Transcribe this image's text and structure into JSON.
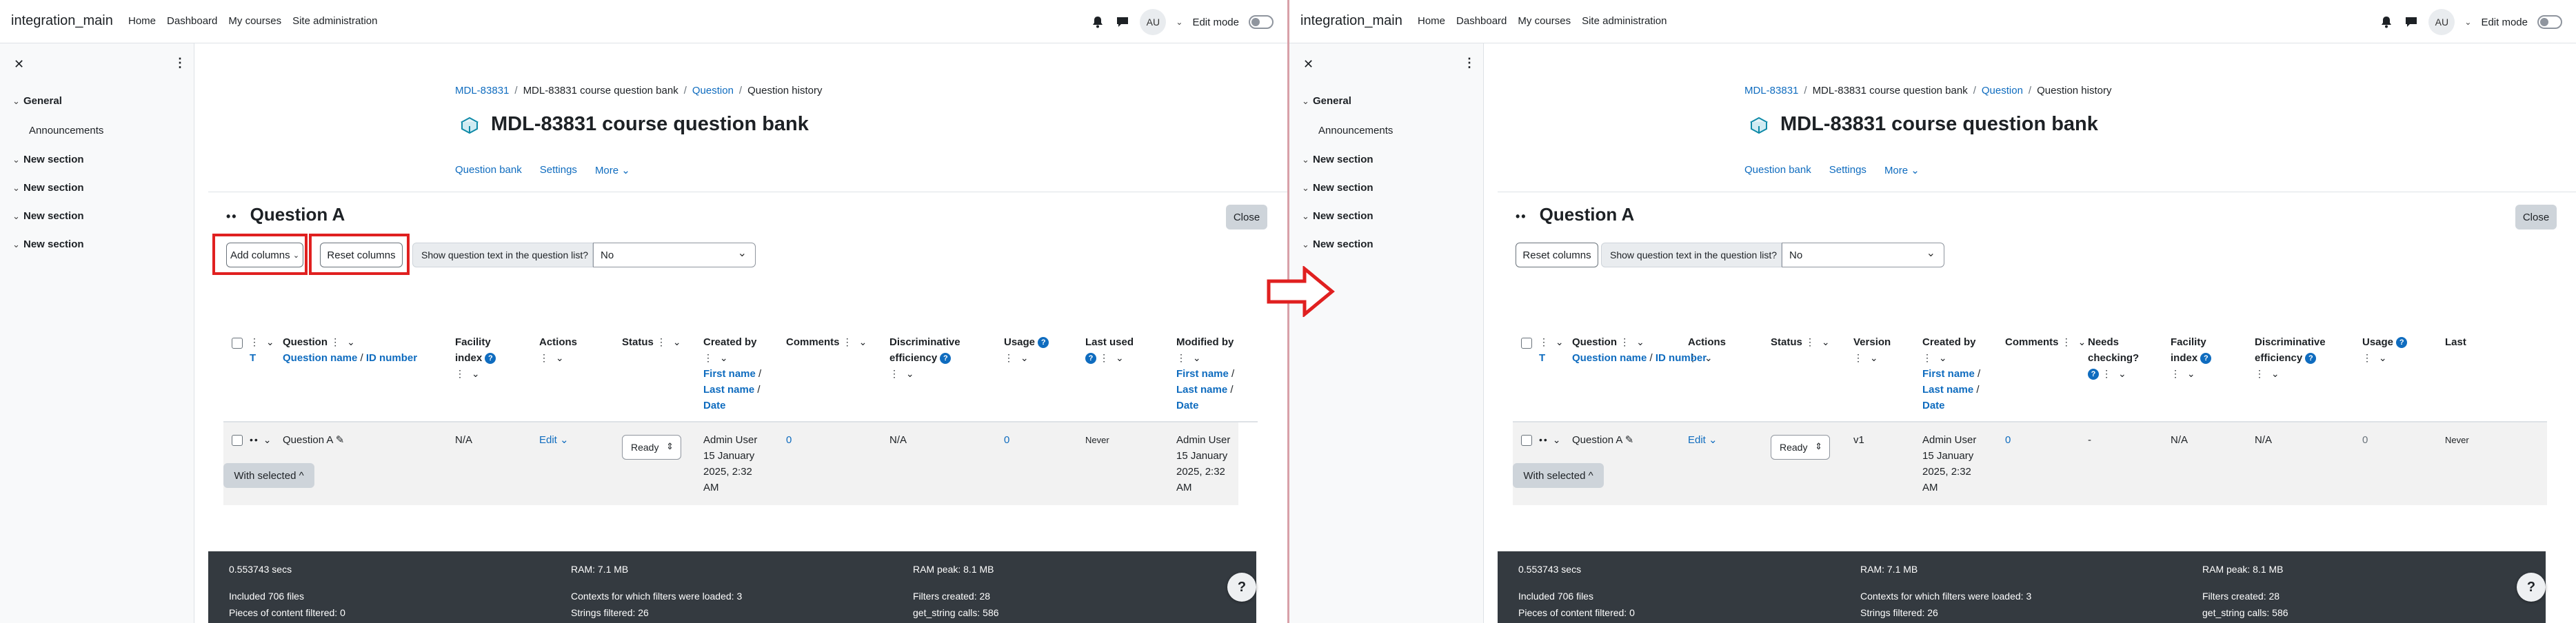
{
  "site": {
    "brand": "integration_main",
    "nav": [
      "Home",
      "Dashboard",
      "My courses",
      "Site administration"
    ],
    "avatar": "AU",
    "edit_mode": "Edit mode"
  },
  "drawer": {
    "close": "✕",
    "menu": "⋮",
    "sections": [
      {
        "label": "General",
        "items": [
          "Announcements"
        ]
      },
      {
        "label": "New section",
        "items": []
      },
      {
        "label": "New section",
        "items": []
      },
      {
        "label": "New section",
        "items": []
      },
      {
        "label": "New section",
        "items": []
      }
    ]
  },
  "page": {
    "breadcrumb": [
      "MDL-83831",
      "MDL-83831 course question bank",
      "Question",
      "Question history"
    ],
    "title": "MDL-83831 course question bank",
    "subnav": [
      "Question bank",
      "Settings",
      "More ⌄"
    ],
    "question_title": "Question A",
    "close": "Close",
    "add_columns": "Add columns",
    "reset_columns": "Reset columns",
    "show_text_label": "Show question text in the question list?",
    "show_text_value": "No",
    "with_selected": "With selected ^"
  },
  "table": {
    "sep": "/",
    "ctl_dots": "⋮ ⌄",
    "h_question": "Question",
    "h_question_name": "Question name",
    "h_id_number": "ID number",
    "h_t": "T",
    "h_facility": "Facility",
    "h_facility2": "index",
    "h_actions": "Actions",
    "h_status": "Status",
    "h_version": "Version",
    "h_created": "Created by",
    "h_first": "First name",
    "h_last": "Last name",
    "h_date": "Date",
    "h_comments": "Comments",
    "h_needs": "Needs",
    "h_checking": "checking?",
    "h_disc": "Discriminative",
    "h_efficiency": "efficiency",
    "h_usage": "Usage",
    "h_lastused": "Last used",
    "h_last_short": "Last",
    "h_modified": "Modified by",
    "row": {
      "name": "Question A",
      "facility": "N/A",
      "actions": "Edit ⌄",
      "status": "Ready",
      "version": "v1",
      "created": [
        "Admin User",
        "15 January",
        "2025, 2:32",
        "AM"
      ],
      "comments": "0",
      "needs_checking": "-",
      "disc": "N/A",
      "usage": "0",
      "last_used": "Never",
      "modified": [
        "Admin User",
        "15 January",
        "2025, 2:32",
        "AM"
      ]
    }
  },
  "footer": {
    "secs": "0.553743 secs",
    "ram": "RAM: 7.1 MB",
    "ram_peak": "RAM peak: 8.1 MB",
    "files": "Included 706 files",
    "contexts": "Contexts for which filters were loaded: 3",
    "filters": "Filters created: 28",
    "pieces": "Pieces of content filtered: 0",
    "strings": "Strings filtered: 26",
    "getstring": "get_string calls: 586",
    "help": "?"
  }
}
